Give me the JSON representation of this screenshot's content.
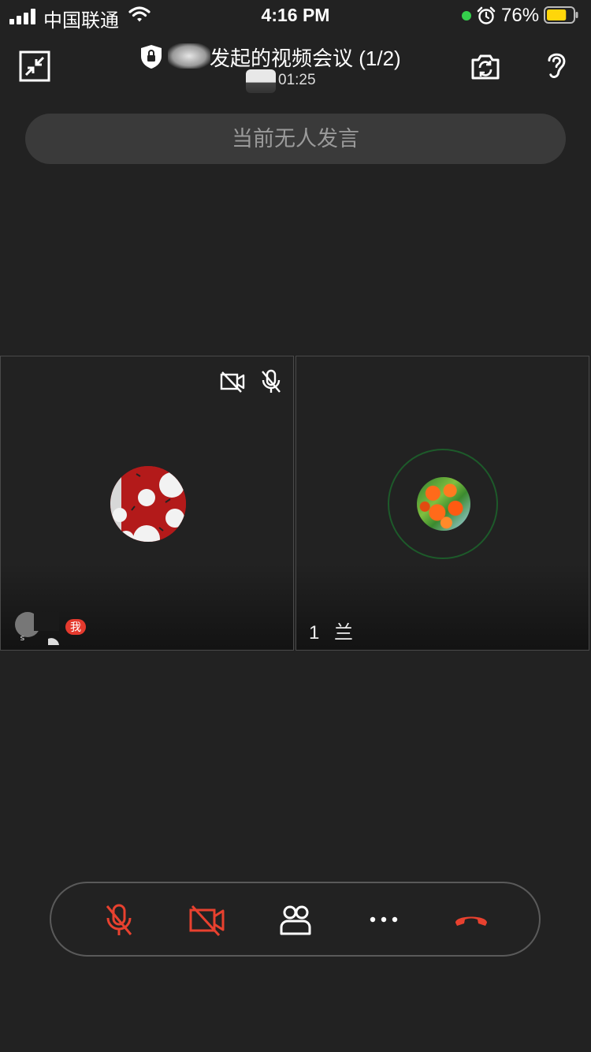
{
  "status_bar": {
    "carrier": "中国联通",
    "time": "4:16 PM",
    "battery_percent": "76%",
    "battery_level": 0.76,
    "colors": {
      "battery_fill": "#ffd60a",
      "camera_indicator": "#35d04c"
    }
  },
  "header": {
    "title": "发起的视频会议 (1/2)",
    "duration": "01:25",
    "icons": [
      "shrink-window-icon",
      "lock-icon",
      "switch-camera-icon",
      "ear-icon"
    ]
  },
  "speaking_status": "当前无人发言",
  "participants": [
    {
      "name_visible": "",
      "me_badge": "我",
      "camera_off": true,
      "mic_muted": true,
      "avatar": "red-dotted-avatar"
    },
    {
      "name_visible": "1 兰",
      "speaking_ring": true,
      "avatar": "orange-tree-avatar"
    }
  ],
  "toolbar": {
    "buttons": [
      "mic-muted-icon",
      "camera-off-icon",
      "members-icon",
      "more-icon",
      "hang-up-icon"
    ],
    "colors": {
      "danger": "#e8412f",
      "neutral": "#ffffff"
    }
  }
}
